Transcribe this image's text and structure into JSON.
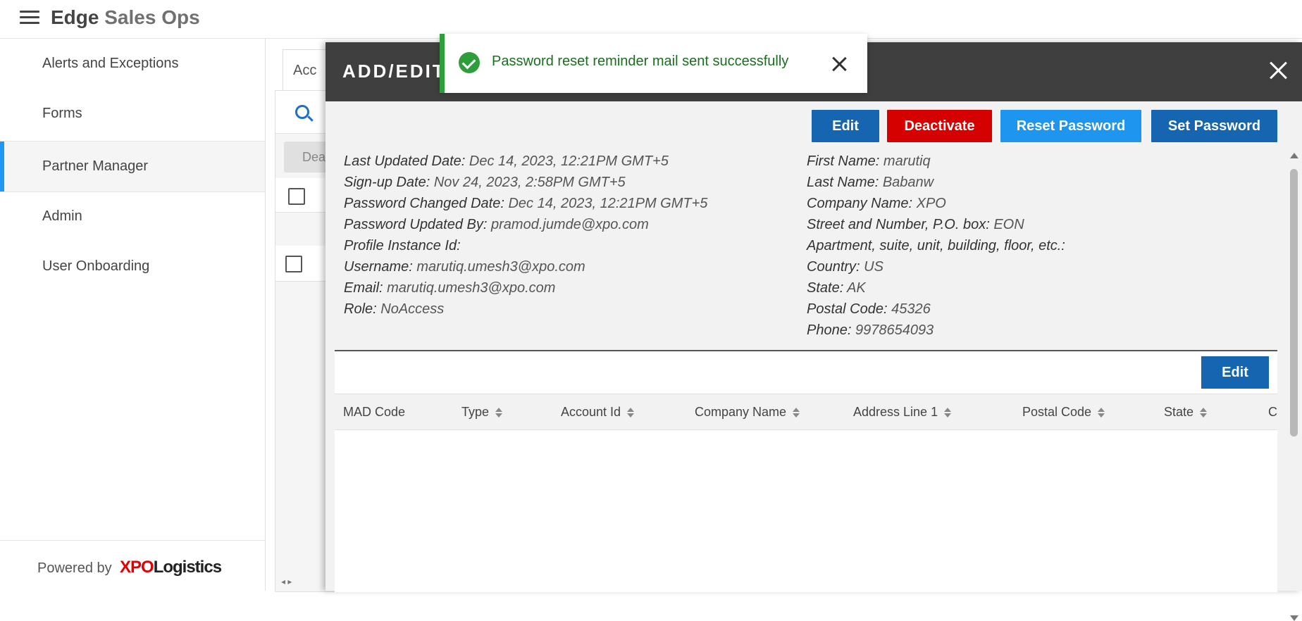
{
  "app": {
    "title_main": "Edge",
    "title_sub": "Sales Ops"
  },
  "sidebar": {
    "items": [
      {
        "label": "Alerts and Exceptions"
      },
      {
        "label": "Forms"
      },
      {
        "label": "Partner Manager",
        "active": true
      },
      {
        "label": "Admin"
      },
      {
        "label": "User Onboarding"
      }
    ],
    "powered_by": "Powered by",
    "logo_xpo": "XPO",
    "logo_logistics": "Logistics"
  },
  "background": {
    "tab_label": "Acc",
    "button_label": "Dea"
  },
  "toast": {
    "message": "Password reset reminder mail sent successfully"
  },
  "modal": {
    "title": "ADD/EDIT",
    "buttons": {
      "edit": "Edit",
      "deactivate": "Deactivate",
      "reset_password": "Reset Password",
      "set_password": "Set Password"
    },
    "left_details": [
      {
        "label": "Last Updated Date:",
        "value": "Dec 14, 2023, 12:21PM GMT+5"
      },
      {
        "label": "Sign-up Date:",
        "value": "Nov 24, 2023, 2:58PM GMT+5"
      },
      {
        "label": "Password Changed Date:",
        "value": "Dec 14, 2023, 12:21PM GMT+5"
      },
      {
        "label": "Password Updated By:",
        "value": "pramod.jumde@xpo.com"
      },
      {
        "label": "Profile Instance Id:",
        "value": ""
      },
      {
        "label": "Username:",
        "value": "marutiq.umesh3@xpo.com"
      },
      {
        "label": "Email:",
        "value": "marutiq.umesh3@xpo.com"
      },
      {
        "label": "Role:",
        "value": "NoAccess"
      }
    ],
    "right_details": [
      {
        "label": "First Name:",
        "value": "marutiq"
      },
      {
        "label": "Last Name:",
        "value": "Babanw"
      },
      {
        "label": "Company Name:",
        "value": "XPO"
      },
      {
        "label": "Street and Number, P.O. box:",
        "value": "EON"
      },
      {
        "label": "Apartment, suite, unit, building, floor, etc.:",
        "value": ""
      },
      {
        "label": "Country:",
        "value": "US"
      },
      {
        "label": "State:",
        "value": "AK"
      },
      {
        "label": "Postal Code:",
        "value": "45326"
      },
      {
        "label": "Phone:",
        "value": "9978654093"
      }
    ],
    "accounts": {
      "edit_label": "Edit",
      "columns": [
        "MAD Code",
        "Type",
        "Account Id",
        "Company Name",
        "Address Line 1",
        "Postal Code",
        "State",
        "C"
      ]
    }
  }
}
